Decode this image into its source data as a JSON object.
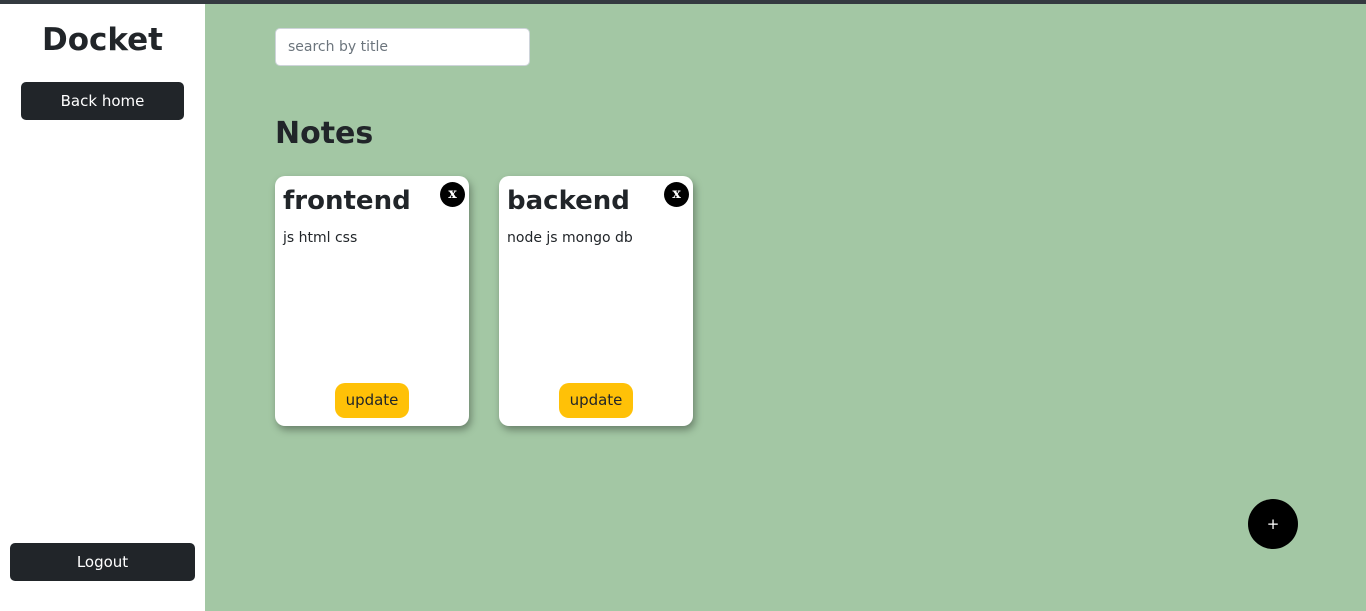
{
  "sidebar": {
    "brand": "Docket",
    "back_home_label": "Back home",
    "logout_label": "Logout"
  },
  "search": {
    "placeholder": "search by title",
    "value": ""
  },
  "main": {
    "section_title": "Notes",
    "notes": [
      {
        "title": "frontend",
        "body": "js html css",
        "delete_label": "x",
        "update_label": "update"
      },
      {
        "title": "backend",
        "body": "node js mongo db",
        "delete_label": "x",
        "update_label": "update"
      }
    ],
    "add_label": "+"
  },
  "colors": {
    "main_background": "#a3c7a4",
    "dark_button": "#212529",
    "update_button": "#ffc107",
    "fab": "#000000"
  }
}
